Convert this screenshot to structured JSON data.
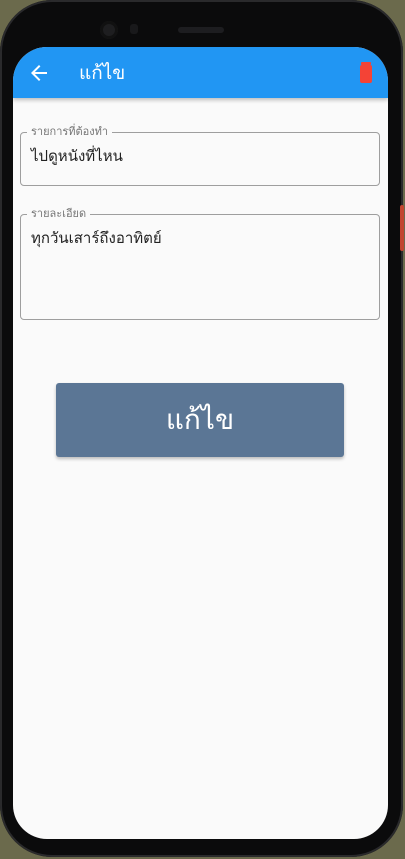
{
  "appbar": {
    "title": "แก้ไข",
    "back_icon": "arrow-left-icon",
    "delete_icon": "trash-icon",
    "delete_color": "#f44336",
    "color": "#2196f3"
  },
  "form": {
    "task": {
      "label": "รายการที่ต้องทำ",
      "value": "ไปดูหนังที่ไหน"
    },
    "details": {
      "label": "รายละเอียด",
      "value": "ทุกวันเสาร์ถึงอาทิตย์"
    }
  },
  "submit": {
    "label": "แก้ไข",
    "color": "#5b7695"
  }
}
